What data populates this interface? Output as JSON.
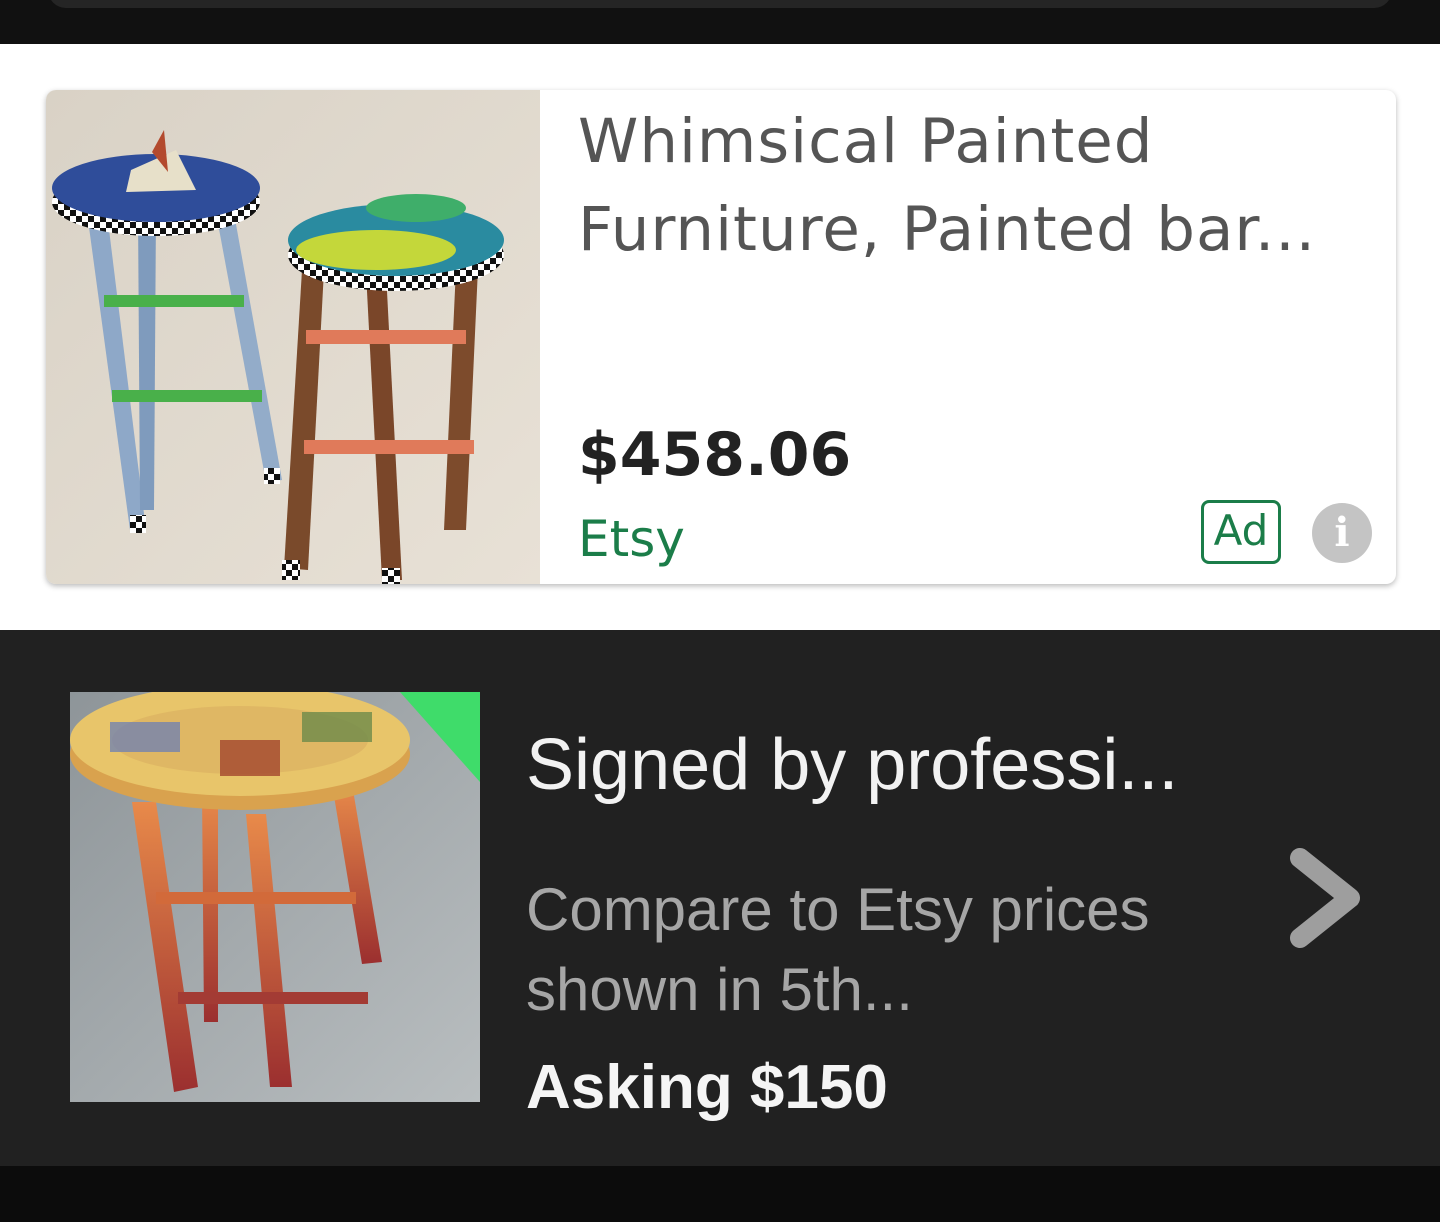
{
  "ad": {
    "title": "Whimsical Painted Furniture, Painted bar...",
    "price": "$458.06",
    "seller": "Etsy",
    "badge": "Ad",
    "info_glyph": "i",
    "image_icon": "painted-bar-stools-photo",
    "colors": {
      "seller": "#1b7d49",
      "badge": "#1b7d49"
    }
  },
  "listing": {
    "title": "Signed by professi...",
    "description": "Compare to Etsy prices shown in 5th...",
    "price": "Asking $150",
    "image_icon": "painted-stool-photo",
    "chevron_icon": "chevron-right-icon",
    "colors": {
      "corner_marker": "#3fdc6a"
    }
  }
}
